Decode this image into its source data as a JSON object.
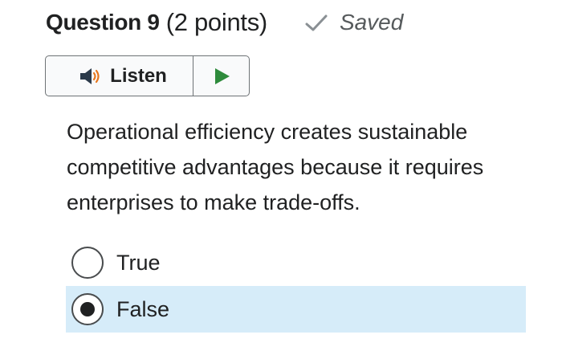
{
  "header": {
    "title": "Question 9",
    "points": "(2 points)",
    "status": "Saved"
  },
  "listen": {
    "label": "Listen",
    "speaker_icon": "speaker-icon",
    "play_icon": "play-icon",
    "play_color": "#2e8b3c",
    "speaker_color": "#2b3a4a",
    "sound_wave_color": "#e8771d"
  },
  "question": {
    "text": "Operational efficiency creates sustainable competitive advantages because it requires enterprises to make trade-offs."
  },
  "options": [
    {
      "label": "True",
      "selected": false
    },
    {
      "label": "False",
      "selected": true
    }
  ],
  "colors": {
    "selected_background": "#d6ecf9",
    "saved_check": "#8a9094"
  }
}
